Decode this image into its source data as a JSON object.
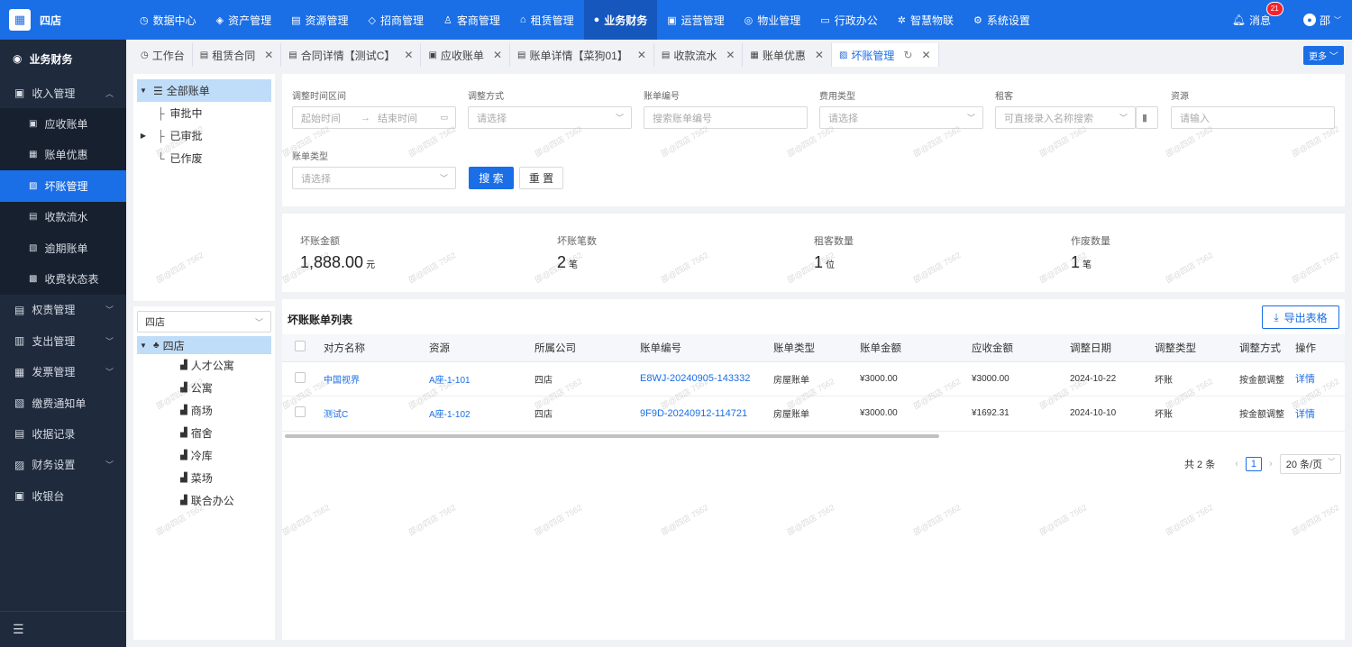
{
  "app": {
    "store_name": "四店"
  },
  "topnav": [
    {
      "label": "数据中心",
      "icon": "◷"
    },
    {
      "label": "资产管理",
      "icon": "◈"
    },
    {
      "label": "资源管理",
      "icon": "▤"
    },
    {
      "label": "招商管理",
      "icon": "◇"
    },
    {
      "label": "客商管理",
      "icon": "♙"
    },
    {
      "label": "租赁管理",
      "icon": "⌂"
    },
    {
      "label": "业务财务",
      "icon": "●"
    },
    {
      "label": "运营管理",
      "icon": "▣"
    },
    {
      "label": "物业管理",
      "icon": "◎"
    },
    {
      "label": "行政办公",
      "icon": "▭"
    },
    {
      "label": "智慧物联",
      "icon": "✲"
    },
    {
      "label": "系统设置",
      "icon": "⚙"
    }
  ],
  "header": {
    "messages_label": "消息",
    "messages_count": "21",
    "user_name": "邵",
    "user_avatar": "●"
  },
  "sidebar": {
    "title": "业务财务",
    "groups": [
      {
        "label": "收入管理",
        "icon": "▣",
        "children": [
          {
            "label": "应收账单",
            "icon": "▣"
          },
          {
            "label": "账单优惠",
            "icon": "▦"
          },
          {
            "label": "坏账管理",
            "icon": "▨"
          },
          {
            "label": "收款流水",
            "icon": "▤"
          },
          {
            "label": "逾期账单",
            "icon": "▧"
          },
          {
            "label": "收费状态表",
            "icon": "▩"
          }
        ]
      },
      {
        "label": "权责管理",
        "icon": "▤"
      },
      {
        "label": "支出管理",
        "icon": "▥"
      },
      {
        "label": "发票管理",
        "icon": "▦"
      },
      {
        "label": "缴费通知单",
        "icon": "▧"
      },
      {
        "label": "收据记录",
        "icon": "▤"
      },
      {
        "label": "财务设置",
        "icon": "▨"
      },
      {
        "label": "收银台",
        "icon": "▣"
      }
    ],
    "collapse_icon": "☰"
  },
  "tabs": [
    {
      "label": "工作台",
      "icon": "◷"
    },
    {
      "label": "租赁合同",
      "icon": "▤"
    },
    {
      "label": "合同详情【测试C】",
      "icon": "▤"
    },
    {
      "label": "应收账单",
      "icon": "▣"
    },
    {
      "label": "账单详情【菜狗01】",
      "icon": "▤"
    },
    {
      "label": "收款流水",
      "icon": "▤"
    },
    {
      "label": "账单优惠",
      "icon": "▦"
    },
    {
      "label": "坏账管理",
      "icon": "▨"
    }
  ],
  "more_label": "更多 ﹀",
  "tree_top": {
    "root": "全部账单",
    "children": [
      "审批中",
      "已审批",
      "已作废"
    ]
  },
  "tree_bottom": {
    "select_value": "四店",
    "root": "四店",
    "children": [
      "人才公寓",
      "公寓",
      "商场",
      "宿舍",
      "冷库",
      "菜场",
      "联合办公"
    ]
  },
  "filters": {
    "time_range_label": "调整时间区间",
    "start_placeholder": "起始时间",
    "end_placeholder": "结束时间",
    "method_label": "调整方式",
    "method_placeholder": "请选择",
    "bill_no_label": "账单编号",
    "bill_no_placeholder": "搜索账单编号",
    "fee_type_label": "费用类型",
    "fee_type_placeholder": "请选择",
    "tenant_label": "租客",
    "tenant_placeholder": "可直接录入名称搜索",
    "resource_label": "资源",
    "resource_placeholder": "请输入",
    "bill_type_label": "账单类型",
    "bill_type_placeholder": "请选择",
    "search_btn": "搜 索",
    "reset_btn": "重 置"
  },
  "stats": [
    {
      "label": "坏账金额",
      "value": "1,888.00",
      "unit": "元"
    },
    {
      "label": "坏账笔数",
      "value": "2",
      "unit": "笔"
    },
    {
      "label": "租客数量",
      "value": "1",
      "unit": "位"
    },
    {
      "label": "作废数量",
      "value": "1",
      "unit": "笔"
    }
  ],
  "list": {
    "title": "坏账账单列表",
    "export_btn": "导出表格",
    "columns": [
      "对方名称",
      "资源",
      "所属公司",
      "账单编号",
      "账单类型",
      "账单金额",
      "应收金额",
      "调整日期",
      "调整类型",
      "调整方式",
      "操作"
    ],
    "rows": [
      {
        "party": "中国视界",
        "resource": "A座-1-101",
        "company": "四店",
        "bill_no": "E8WJ-20240905-143332",
        "bill_type": "房屋账单",
        "amount": "¥3000.00",
        "receivable": "¥3000.00",
        "date": "2024-10-22",
        "adj_type": "坏账",
        "adj_method": "按金额调整",
        "action": "详情"
      },
      {
        "party": "测试C",
        "resource": "A座-1-102",
        "company": "四店",
        "bill_no": "9F9D-20240912-114721",
        "bill_type": "房屋账单",
        "amount": "¥3000.00",
        "receivable": "¥1692.31",
        "date": "2024-10-10",
        "adj_type": "坏账",
        "adj_method": "按金额调整",
        "action": "详情"
      }
    ]
  },
  "pagination": {
    "total": "共 2 条",
    "current": "1",
    "page_size": "20 条/页"
  },
  "watermark": "邵@四店 7562"
}
